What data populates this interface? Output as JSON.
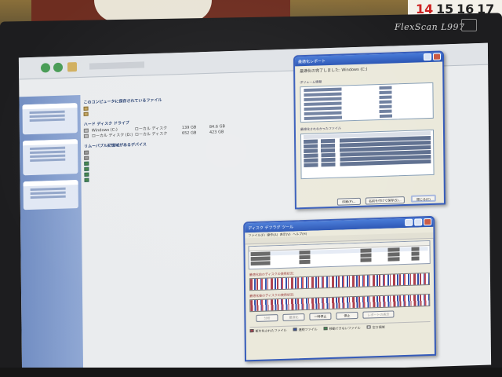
{
  "photo": {
    "monitor_brand": "FlexScan L997",
    "calendar_numbers": [
      "14",
      "15",
      "16",
      "17"
    ]
  },
  "report_dialog": {
    "title": "最適化レポート",
    "subtitle": "最適化の完了しました: Windows (C:)",
    "volume_heading": "ボリューム情報",
    "fragment_heading": "最適化されなかったファイル",
    "buttons": {
      "print": "印刷(P)...",
      "save": "名前を付けて保存(S)...",
      "close": "閉じる(C)"
    }
  },
  "defrag_window": {
    "title": "ディスク デフラグ ツール",
    "menu": [
      "ファイル(F)",
      "操作(A)",
      "表示(V)",
      "ヘルプ(H)"
    ],
    "columns": [
      "ボリューム",
      "セッションの状態",
      "ファイル システム",
      "容量",
      "空き領域",
      "空き領域の割合"
    ],
    "volumes": [
      {
        "name": "Windows (C:)",
        "status": "最適化済み",
        "fs": "NTFS",
        "capacity": "139 GB",
        "free": "84.60 GB",
        "pct": "60 %"
      },
      {
        "name": "(D:)",
        "status": "",
        "fs": "NTFS",
        "capacity": "652 GB",
        "free": "423 GB",
        "pct": "64 %"
      },
      {
        "name": "NEC-RESTORE",
        "status": "",
        "fs": "FAT32",
        "capacity": "100 GB",
        "free": "8.71 GB",
        "pct": "69 %"
      }
    ],
    "before_label": "最適化前のディスクの使用状況:",
    "after_label": "最適化後のディスクの使用状況:",
    "buttons": {
      "analyze": "分析",
      "defrag": "最適化",
      "pause": "一時停止",
      "stop": "停止",
      "report": "レポートの表示"
    },
    "legend": [
      "断片化されたファイル",
      "連続ファイル",
      "移動できないファイル",
      "空き領域"
    ],
    "colors": {
      "fragmented": "#c23a4a",
      "contiguous": "#2a4fc0",
      "unmovable": "#2f9a48",
      "free": "#ffffff"
    }
  },
  "explorer": {
    "section_local": "このコンピュータに保存されているファイル",
    "section_hdd": "ハード ディスク ドライブ",
    "section_removable": "リムーバブル記憶域があるデバイス",
    "hdd_items": [
      {
        "name": "Windows (C:)",
        "type": "ローカル ディスク",
        "total": "139 GB",
        "free": "84.6 GB"
      },
      {
        "name": "ローカル ディスク (D:)",
        "type": "ローカル ディスク",
        "total": "652 GB",
        "free": "423 GB"
      }
    ]
  }
}
